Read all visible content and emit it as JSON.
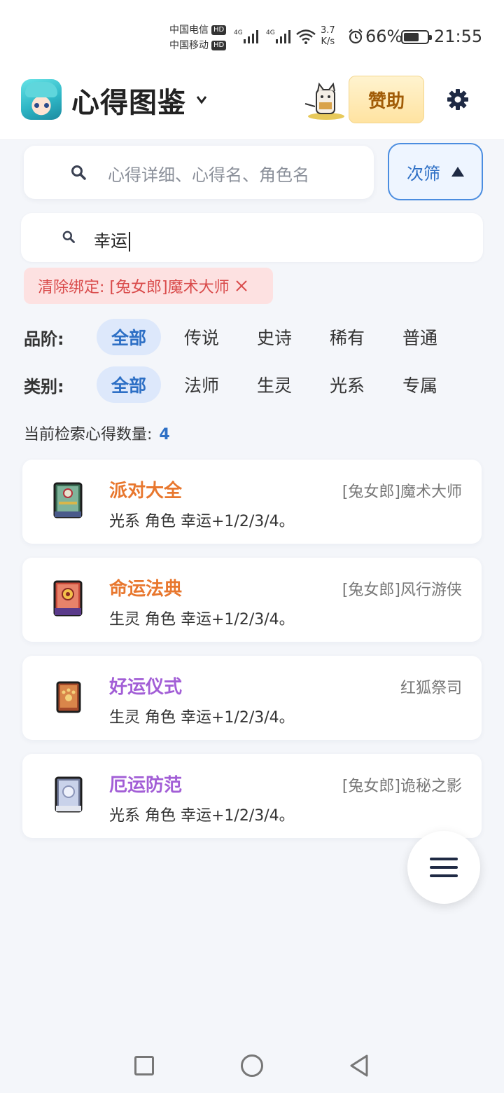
{
  "status_bar": {
    "carrier1": "中国电信",
    "carrier2": "中国移动",
    "hd_label": "HD",
    "network1": "4G",
    "network2": "4G",
    "speed_value": "3.7",
    "speed_unit": "K/s",
    "battery": "66%",
    "battery_level": 0.66,
    "time": "21:55"
  },
  "header": {
    "title": "心得图鉴",
    "sponsor_label": "赞助"
  },
  "search": {
    "placeholder": "心得详细、心得名、角色名",
    "filter_label": "次筛",
    "sub_query": "幸运"
  },
  "bind_chip": {
    "label": "清除绑定: [兔女郎]魔术大师"
  },
  "filters": {
    "rarity": {
      "label": "品阶:",
      "options": [
        "全部",
        "传说",
        "史诗",
        "稀有",
        "普通"
      ],
      "selected": "全部"
    },
    "category": {
      "label": "类别:",
      "options": [
        "全部",
        "法师",
        "生灵",
        "光系",
        "专属"
      ],
      "selected": "全部"
    }
  },
  "result_count": {
    "label": "当前检索心得数量:",
    "value": "4"
  },
  "cards": [
    {
      "name": "派对大全",
      "owner": "[兔女郎]魔术大师",
      "desc": "光系 角色 幸运+1/2/3/4。",
      "name_color": "#e8772e",
      "icon": "grimoire-green-icon"
    },
    {
      "name": "命运法典",
      "owner": "[兔女郎]风行游侠",
      "desc": "生灵 角色 幸运+1/2/3/4。",
      "name_color": "#e8772e",
      "icon": "grimoire-red-icon"
    },
    {
      "name": "好运仪式",
      "owner": "红狐祭司",
      "desc": "生灵 角色 幸运+1/2/3/4。",
      "name_color": "#a25ed6",
      "icon": "paw-book-icon"
    },
    {
      "name": "厄运防范",
      "owner": "[兔女郎]诡秘之影",
      "desc": "光系 角色 幸运+1/2/3/4。",
      "name_color": "#a25ed6",
      "icon": "silver-book-icon"
    }
  ]
}
